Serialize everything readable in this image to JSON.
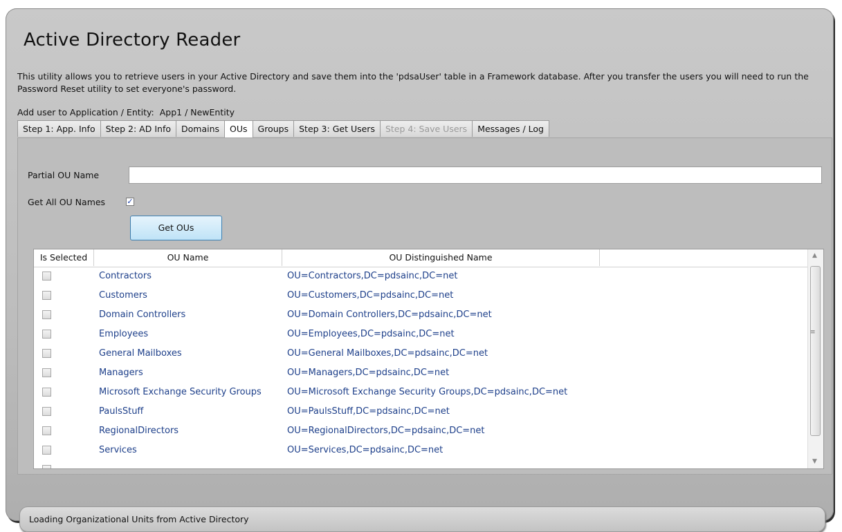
{
  "app": {
    "title": "Active Directory Reader",
    "description": "This utility allows you to retrieve users in your Active Directory and save them into the 'pdsaUser' table in a Framework database. After you transfer the users you will need to run the Password Reset utility to set everyone's password.",
    "entity_label": "Add user to Application / Entity:",
    "entity_value": "App1 / NewEntity"
  },
  "tabs": [
    {
      "label": "Step 1: App. Info",
      "state": "normal"
    },
    {
      "label": "Step 2: AD Info",
      "state": "normal"
    },
    {
      "label": "Domains",
      "state": "normal"
    },
    {
      "label": "OUs",
      "state": "active"
    },
    {
      "label": "Groups",
      "state": "normal"
    },
    {
      "label": "Step 3: Get Users",
      "state": "normal"
    },
    {
      "label": "Step 4: Save Users",
      "state": "disabled"
    },
    {
      "label": "Messages / Log",
      "state": "normal"
    }
  ],
  "ou_panel": {
    "partial_label": "Partial OU Name",
    "partial_value": "",
    "get_all_label": "Get All OU Names",
    "get_all_checked": true,
    "check_glyph": "✓",
    "get_button": "Get OUs"
  },
  "grid": {
    "columns": [
      "Is Selected",
      "OU Name",
      "OU Distinguished Name"
    ],
    "rows": [
      {
        "name": "Contractors",
        "dn": "OU=Contractors,DC=pdsainc,DC=net"
      },
      {
        "name": "Customers",
        "dn": "OU=Customers,DC=pdsainc,DC=net"
      },
      {
        "name": "Domain Controllers",
        "dn": "OU=Domain Controllers,DC=pdsainc,DC=net"
      },
      {
        "name": "Employees",
        "dn": "OU=Employees,DC=pdsainc,DC=net"
      },
      {
        "name": "General Mailboxes",
        "dn": "OU=General Mailboxes,DC=pdsainc,DC=net"
      },
      {
        "name": "Managers",
        "dn": "OU=Managers,DC=pdsainc,DC=net"
      },
      {
        "name": "Microsoft Exchange Security Groups",
        "dn": "OU=Microsoft Exchange Security Groups,DC=pdsainc,DC=net"
      },
      {
        "name": "PaulsStuff",
        "dn": "OU=PaulsStuff,DC=pdsainc,DC=net"
      },
      {
        "name": "RegionalDirectors",
        "dn": "OU=RegionalDirectors,DC=pdsainc,DC=net"
      },
      {
        "name": "Services",
        "dn": "OU=Services,DC=pdsainc,DC=net"
      }
    ]
  },
  "status": {
    "text": "Loading Organizational Units from Active Directory"
  },
  "colors": {
    "link_text": "#1d3f8a",
    "button_border": "#3c7fb1",
    "check_blue": "#1a3ea8"
  }
}
